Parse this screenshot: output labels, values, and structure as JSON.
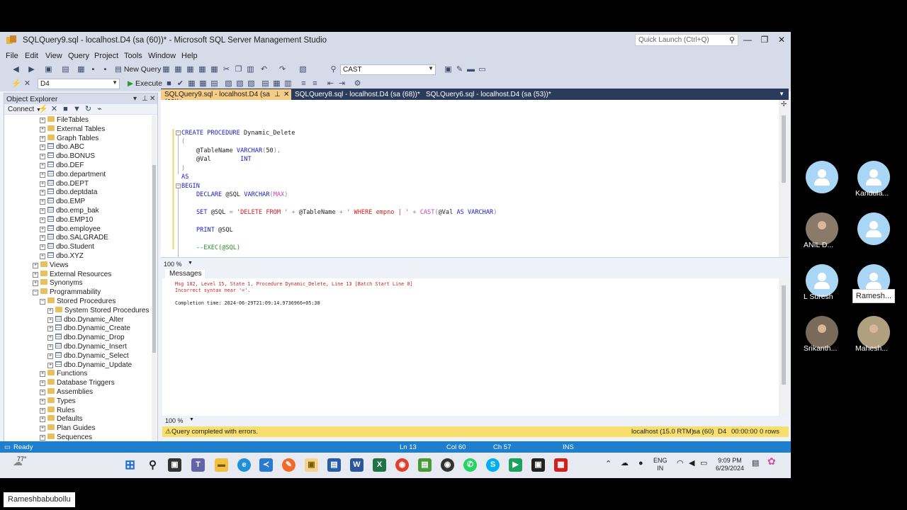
{
  "window": {
    "title": "SQLQuery9.sql - localhost.D4 (sa (60))* - Microsoft SQL Server Management Studio",
    "quick_launch_placeholder": "Quick Launch (Ctrl+Q)"
  },
  "menu": [
    "File",
    "Edit",
    "View",
    "Query",
    "Project",
    "Tools",
    "Window",
    "Help"
  ],
  "toolbar": {
    "new_query_label": "New Query",
    "search_combo_value": "CAST",
    "database_combo_value": "D4",
    "execute_label": "Execute"
  },
  "object_explorer": {
    "title": "Object Explorer",
    "connect_label": "Connect",
    "tree": [
      {
        "label": "FileTables",
        "level": 4,
        "icon": "folder",
        "expander": "+"
      },
      {
        "label": "External Tables",
        "level": 4,
        "icon": "folder",
        "expander": "+"
      },
      {
        "label": "Graph Tables",
        "level": 4,
        "icon": "folder",
        "expander": "+"
      },
      {
        "label": "dbo.ABC",
        "level": 4,
        "icon": "table",
        "expander": "+"
      },
      {
        "label": "dbo.BONUS",
        "level": 4,
        "icon": "table",
        "expander": "+"
      },
      {
        "label": "dbo.DEF",
        "level": 4,
        "icon": "table",
        "expander": "+"
      },
      {
        "label": "dbo.department",
        "level": 4,
        "icon": "table",
        "expander": "+"
      },
      {
        "label": "dbo.DEPT",
        "level": 4,
        "icon": "table",
        "expander": "+"
      },
      {
        "label": "dbo.deptdata",
        "level": 4,
        "icon": "table",
        "expander": "+"
      },
      {
        "label": "dbo.EMP",
        "level": 4,
        "icon": "table",
        "expander": "+"
      },
      {
        "label": "dbo.emp_bak",
        "level": 4,
        "icon": "table",
        "expander": "+"
      },
      {
        "label": "dbo.EMP10",
        "level": 4,
        "icon": "table",
        "expander": "+"
      },
      {
        "label": "dbo.employee",
        "level": 4,
        "icon": "table",
        "expander": "+"
      },
      {
        "label": "dbo.SALGRADE",
        "level": 4,
        "icon": "table",
        "expander": "+"
      },
      {
        "label": "dbo.Student",
        "level": 4,
        "icon": "table",
        "expander": "+"
      },
      {
        "label": "dbo.XYZ",
        "level": 4,
        "icon": "table",
        "expander": "+"
      },
      {
        "label": "Views",
        "level": 3,
        "icon": "folder",
        "expander": "+"
      },
      {
        "label": "External Resources",
        "level": 3,
        "icon": "folder",
        "expander": "+"
      },
      {
        "label": "Synonyms",
        "level": 3,
        "icon": "folder",
        "expander": "+"
      },
      {
        "label": "Programmability",
        "level": 3,
        "icon": "folder",
        "expander": "-"
      },
      {
        "label": "Stored Procedures",
        "level": 4,
        "icon": "folder",
        "expander": "-"
      },
      {
        "label": "System Stored Procedures",
        "level": 5,
        "icon": "folder",
        "expander": "+"
      },
      {
        "label": "dbo.Dynamic_Alter",
        "level": 5,
        "icon": "table",
        "expander": "+"
      },
      {
        "label": "dbo.Dynamic_Create",
        "level": 5,
        "icon": "table",
        "expander": "+"
      },
      {
        "label": "dbo.Dynamic_Drop",
        "level": 5,
        "icon": "table",
        "expander": "+"
      },
      {
        "label": "dbo.Dynamic_Insert",
        "level": 5,
        "icon": "table",
        "expander": "+"
      },
      {
        "label": "dbo.Dynamic_Select",
        "level": 5,
        "icon": "table",
        "expander": "+"
      },
      {
        "label": "dbo.Dynamic_Update",
        "level": 5,
        "icon": "table",
        "expander": "+"
      },
      {
        "label": "Functions",
        "level": 4,
        "icon": "folder",
        "expander": "+"
      },
      {
        "label": "Database Triggers",
        "level": 4,
        "icon": "folder",
        "expander": "+"
      },
      {
        "label": "Assemblies",
        "level": 4,
        "icon": "folder",
        "expander": "+"
      },
      {
        "label": "Types",
        "level": 4,
        "icon": "folder",
        "expander": "+"
      },
      {
        "label": "Rules",
        "level": 4,
        "icon": "folder",
        "expander": "+"
      },
      {
        "label": "Defaults",
        "level": 4,
        "icon": "folder",
        "expander": "+"
      },
      {
        "label": "Plan Guides",
        "level": 4,
        "icon": "folder",
        "expander": "+"
      },
      {
        "label": "Sequences",
        "level": 4,
        "icon": "folder",
        "expander": "+"
      }
    ]
  },
  "tabs": [
    {
      "label": "SQLQuery9.sql - localhost.D4 (sa (60))*",
      "active": true
    },
    {
      "label": "SQLQuery8.sql - localhost.D4 (sa (68))*",
      "active": false
    },
    {
      "label": "SQLQuery6.sql - localhost.D4 (sa (53))*",
      "active": false
    }
  ],
  "editor": {
    "zoom": "100 %",
    "lines": [
      {
        "indent": 0,
        "fold": "-",
        "segs": [
          [
            "kw",
            "CREATE PROCEDURE "
          ],
          [
            "",
            "Dynamic_Delete"
          ]
        ]
      },
      {
        "indent": 0,
        "fold": "",
        "segs": [
          [
            "gry",
            "("
          ]
        ]
      },
      {
        "indent": 1,
        "fold": "",
        "segs": [
          [
            "",
            "@TableName "
          ],
          [
            "kw",
            "VARCHAR"
          ],
          [
            "gry",
            "("
          ],
          [
            "",
            "50"
          ],
          [
            "gry",
            "),"
          ]
        ]
      },
      {
        "indent": 1,
        "fold": "",
        "segs": [
          [
            "",
            "@Val        "
          ],
          [
            "kw",
            "INT"
          ]
        ]
      },
      {
        "indent": 0,
        "fold": "",
        "segs": [
          [
            "gry",
            ")"
          ]
        ]
      },
      {
        "indent": 0,
        "fold": "",
        "segs": [
          [
            "kw",
            "AS"
          ]
        ]
      },
      {
        "indent": 0,
        "fold": "-",
        "segs": [
          [
            "kw",
            "BEGIN"
          ]
        ]
      },
      {
        "indent": 1,
        "fold": "",
        "segs": [
          [
            "kw",
            "DECLARE "
          ],
          [
            "",
            "@SQL "
          ],
          [
            "kw",
            "VARCHAR"
          ],
          [
            "gry",
            "("
          ],
          [
            "fn",
            "MAX"
          ],
          [
            "gry",
            ")"
          ]
        ]
      },
      {
        "indent": 1,
        "fold": "",
        "segs": []
      },
      {
        "indent": 1,
        "fold": "",
        "segs": [
          [
            "kw",
            "SET "
          ],
          [
            "",
            "@SQL "
          ],
          [
            "gry",
            "= "
          ],
          [
            "str",
            "'DELETE FROM '"
          ],
          [
            "gry",
            " + "
          ],
          [
            "",
            "@TableName "
          ],
          [
            "gry",
            "+ "
          ],
          [
            "str",
            "' WHERE empno | '"
          ],
          [
            "gry",
            " + "
          ],
          [
            "fn",
            "CAST"
          ],
          [
            "gry",
            "("
          ],
          [
            "",
            "@Val "
          ],
          [
            "kw",
            "AS VARCHAR"
          ],
          [
            "gry",
            ")"
          ]
        ]
      },
      {
        "indent": 1,
        "fold": "",
        "segs": []
      },
      {
        "indent": 1,
        "fold": "",
        "segs": [
          [
            "kw",
            "PRINT "
          ],
          [
            "",
            "@SQL"
          ]
        ]
      },
      {
        "indent": 1,
        "fold": "",
        "segs": []
      },
      {
        "indent": 1,
        "fold": "",
        "segs": [
          [
            "cmt",
            "--EXEC(@SQL)"
          ]
        ]
      }
    ]
  },
  "messages": {
    "tab_label": "Messages",
    "zoom": "100 %",
    "error_line1": "Msg 102, Level 15, State 1, Procedure Dynamic_Delete, Line 13 [Batch Start Line 0]",
    "error_line2": "Incorrect syntax near '='.",
    "completion": "Completion time: 2024-06-29T21:09:14.9736966+05:30"
  },
  "query_status": {
    "text": "Query completed with errors.",
    "server": "localhost (15.0 RTM)",
    "user": "sa (60)",
    "db": "D4",
    "elapsed": "00:00:00",
    "rows": "0 rows"
  },
  "status_bar": {
    "ready": "Ready",
    "ln": "Ln 13",
    "col": "Col 60",
    "ch": "Ch 57",
    "ins": "INS"
  },
  "taskbar": {
    "weather": "77°",
    "lang1": "ENG",
    "lang2": "IN",
    "time": "9:09 PM",
    "date": "6/29/2024"
  },
  "participants": [
    {
      "name": "",
      "photo": false
    },
    {
      "name": "Kandula...",
      "photo": false
    },
    {
      "name": "ANIL D...",
      "photo": true
    },
    {
      "name": "",
      "photo": false
    },
    {
      "name": "L Suresh",
      "photo": false
    },
    {
      "name": "",
      "photo": false
    },
    {
      "name": "Srikanth...",
      "photo": true
    },
    {
      "name": "Mahesh...",
      "photo": true
    }
  ],
  "tooltip": "Ramesh...",
  "presenter_name": "Rameshbabubollu",
  "colors": {
    "accent_blue": "#1e7fcf",
    "tab_active": "#f5cc84",
    "error_red": "#d02020",
    "warning_yellow": "#f7df6e"
  }
}
